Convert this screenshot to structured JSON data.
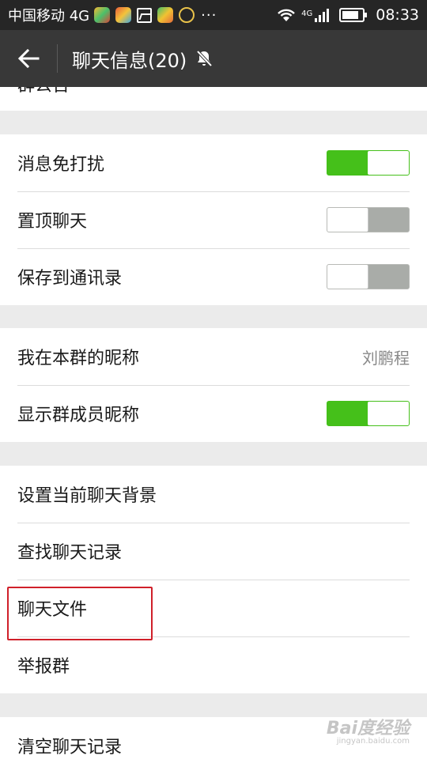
{
  "status_bar": {
    "carrier": "中国移动 4G",
    "more": "···",
    "network": "4G",
    "time": "08:33"
  },
  "header": {
    "back_icon": "arrow-left-icon",
    "title": "聊天信息(20)",
    "mute_icon": "bell-off-icon"
  },
  "top_partial": {
    "label": "群公告"
  },
  "sections": {
    "notifications": [
      {
        "label": "消息免打扰",
        "toggle": true
      },
      {
        "label": "置顶聊天",
        "toggle": false
      },
      {
        "label": "保存到通讯录",
        "toggle": false
      }
    ],
    "nickname": {
      "my_nickname_label": "我在本群的昵称",
      "my_nickname_value": "刘鹏程",
      "show_nicknames_label": "显示群成员昵称",
      "show_nicknames_toggle": true
    },
    "actions": [
      {
        "label": "设置当前聊天背景"
      },
      {
        "label": "查找聊天记录"
      },
      {
        "label": "聊天文件"
      },
      {
        "label": "举报群"
      }
    ],
    "danger": {
      "clear_label": "清空聊天记录"
    }
  },
  "watermark": {
    "brand": "Bai度经验",
    "url": "jingyan.baidu.com"
  },
  "colors": {
    "toggle_on": "#45c01a",
    "toggle_off": "#a9aca8",
    "header_bg": "#383838",
    "status_bg": "#262626",
    "highlight": "#d0202a"
  }
}
